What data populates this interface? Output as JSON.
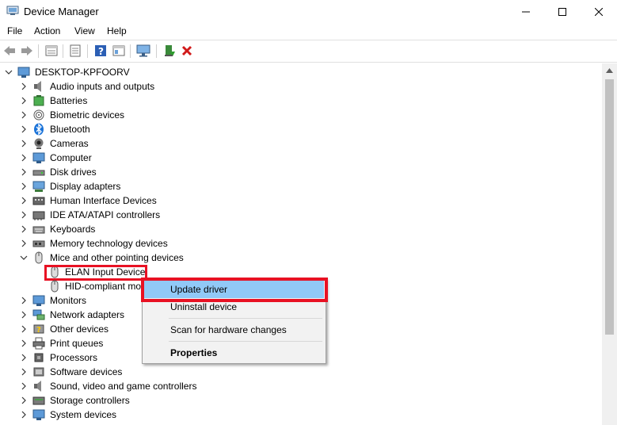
{
  "window": {
    "title": "Device Manager"
  },
  "menu": [
    "File",
    "Action",
    "View",
    "Help"
  ],
  "toolbar": {
    "buttons": [
      "back-arrow-icon",
      "forward-arrow-icon",
      "properties-view-icon",
      "show-hidden-icon",
      "help-icon",
      "action-view-icon",
      "monitor-scan-icon",
      "update-driver-icon",
      "uninstall-x-icon"
    ]
  },
  "tree": {
    "root": "DESKTOP-KPFOORV",
    "items": [
      {
        "label": "Audio inputs and outputs",
        "icon": "speaker-icon",
        "expanded": false
      },
      {
        "label": "Batteries",
        "icon": "battery-icon",
        "expanded": false
      },
      {
        "label": "Biometric devices",
        "icon": "fingerprint-icon",
        "expanded": false
      },
      {
        "label": "Bluetooth",
        "icon": "bluetooth-icon",
        "expanded": false
      },
      {
        "label": "Cameras",
        "icon": "camera-icon",
        "expanded": false
      },
      {
        "label": "Computer",
        "icon": "computer-icon",
        "expanded": false
      },
      {
        "label": "Disk drives",
        "icon": "disk-drive-icon",
        "expanded": false
      },
      {
        "label": "Display adapters",
        "icon": "display-adapter-icon",
        "expanded": false
      },
      {
        "label": "Human Interface Devices",
        "icon": "hid-icon",
        "expanded": false
      },
      {
        "label": "IDE ATA/ATAPI controllers",
        "icon": "ide-controller-icon",
        "expanded": false
      },
      {
        "label": "Keyboards",
        "icon": "keyboard-icon",
        "expanded": false
      },
      {
        "label": "Memory technology devices",
        "icon": "memory-icon",
        "expanded": false
      },
      {
        "label": "Mice and other pointing devices",
        "icon": "mouse-icon",
        "expanded": true,
        "children": [
          {
            "label": "ELAN Input Device",
            "icon": "mouse-icon",
            "selected": true
          },
          {
            "label": "HID-compliant mo",
            "icon": "mouse-icon"
          }
        ]
      },
      {
        "label": "Monitors",
        "icon": "monitor-icon",
        "expanded": false
      },
      {
        "label": "Network adapters",
        "icon": "network-adapter-icon",
        "expanded": false
      },
      {
        "label": "Other devices",
        "icon": "other-devices-icon",
        "expanded": false
      },
      {
        "label": "Print queues",
        "icon": "printer-icon",
        "expanded": false
      },
      {
        "label": "Processors",
        "icon": "processor-icon",
        "expanded": false
      },
      {
        "label": "Software devices",
        "icon": "software-device-icon",
        "expanded": false
      },
      {
        "label": "Sound, video and game controllers",
        "icon": "speaker-icon",
        "expanded": false
      },
      {
        "label": "Storage controllers",
        "icon": "storage-controller-icon",
        "expanded": false
      },
      {
        "label": "System devices",
        "icon": "system-device-icon",
        "expanded": false
      }
    ]
  },
  "context_menu": {
    "items": [
      {
        "label": "Update driver",
        "highlighted": true,
        "bold": false
      },
      {
        "label": "Uninstall device",
        "highlighted": false,
        "bold": false
      },
      {
        "separator": true
      },
      {
        "label": "Scan for hardware changes",
        "highlighted": false,
        "bold": false
      },
      {
        "separator": true
      },
      {
        "label": "Properties",
        "highlighted": false,
        "bold": true
      }
    ]
  },
  "colors": {
    "highlight_box": "#e81123",
    "menu_highlight": "#91c9f7",
    "menu_background": "#f2f2f2"
  }
}
